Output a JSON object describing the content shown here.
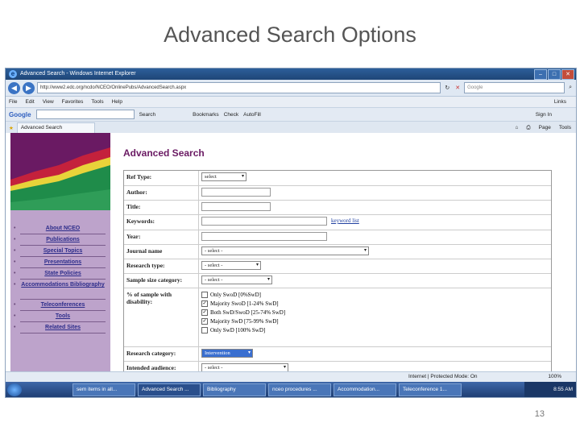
{
  "slide": {
    "title": "Advanced Search Options",
    "page_number": "13"
  },
  "browser": {
    "window_title": "Advanced Search - Windows Internet Explorer",
    "address": "http://www2.edc.org/ncdo/NCEO/OnlinePubs/AdvancedSearch.aspx",
    "search_placeholder": "Google",
    "menu": [
      "File",
      "Edit",
      "View",
      "Favorites",
      "Tools",
      "Help"
    ],
    "links_label": "Links",
    "google_toolbar": [
      "Google",
      "Search",
      "Bookmarks",
      "Check",
      "AutoFill",
      "Sign In"
    ],
    "tab_label": "Advanced Search",
    "tab_tools": [
      "Page",
      "Tools"
    ]
  },
  "sidebar": {
    "items": [
      "About NCEO",
      "Publications",
      "Special Topics",
      "Presentations",
      "State Policies",
      "Accommodations Bibliography",
      "Teleconferences",
      "Tools",
      "Related Sites"
    ]
  },
  "form": {
    "heading": "Advanced Search",
    "ref_type": {
      "label": "Ref Type:",
      "value": "select"
    },
    "author": {
      "label": "Author:"
    },
    "title": {
      "label": "Title:"
    },
    "keywords": {
      "label": "Keywords:",
      "link": "keyword list"
    },
    "year": {
      "label": "Year:"
    },
    "journal": {
      "label": "Journal name",
      "value": "- select -"
    },
    "research_type": {
      "label": "Research type:",
      "value": "- select -"
    },
    "sample_size": {
      "label": "Sample size category:",
      "value": "- select -"
    },
    "disability": {
      "label": "% of sample with disability:",
      "options": [
        {
          "text": "Only SwoD [0%SwD]",
          "checked": false
        },
        {
          "text": "Majority SwoD [1-24% SwD]",
          "checked": true
        },
        {
          "text": "Both SwD/SwoD [25-74% SwD]",
          "checked": true
        },
        {
          "text": "Majority SwD [75-99% SwD]",
          "checked": true
        },
        {
          "text": "Only SwD [100% SwD]",
          "checked": false
        }
      ]
    },
    "research_category": {
      "label": "Research category:",
      "value": "Intervention"
    },
    "audience": {
      "label": "Intended audience:",
      "value": "- select -"
    }
  },
  "status": {
    "zone": "Internet | Protected Mode: On",
    "zoom": "100%"
  },
  "taskbar": {
    "items": [
      "sem items in all...",
      "Advanced Search ...",
      "Bibliography",
      "nceo procedures ...",
      "Accommodation...",
      "Teleconference 1..."
    ],
    "clock": "8:55 AM"
  }
}
